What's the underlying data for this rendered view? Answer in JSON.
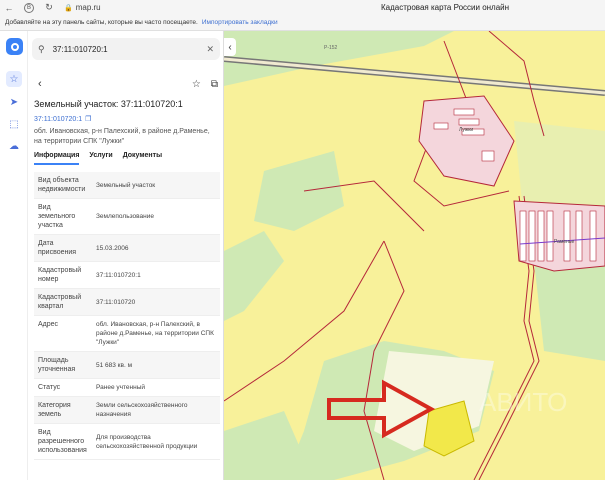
{
  "browser": {
    "url": "map.ru",
    "page_title": "Кадастровая карта России онлайн"
  },
  "bookmarks_bar": {
    "text": "Добавляйте на эту панель сайты, которые вы часто посещаете.",
    "import_link": "Импортировать закладки"
  },
  "search": {
    "query": "37:11:010720:1"
  },
  "parcel": {
    "heading": "Земельный участок: 37:11:010720:1",
    "cad_link": "37:11:010720:1",
    "address_short": "обл. Ивановская, р-н Палехский, в районе д.Раменье, на территории СПК \"Лужки\""
  },
  "tabs": [
    "Информация",
    "Услуги",
    "Документы"
  ],
  "info_rows": [
    {
      "key": "Вид объекта недвижимости",
      "value": "Земельный участок"
    },
    {
      "key": "Вид земельного участка",
      "value": "Землепользование"
    },
    {
      "key": "Дата присвоения",
      "value": "15.03.2006"
    },
    {
      "key": "Кадастровый номер",
      "value": "37:11:010720:1"
    },
    {
      "key": "Кадастровый квартал",
      "value": "37:11:010720"
    },
    {
      "key": "Адрес",
      "value": "обл. Ивановская, р-н Палехский, в районе д.Раменье, на территории СПК \"Лужки\""
    },
    {
      "key": "Площадь уточненная",
      "value": "51 683 кв. м"
    },
    {
      "key": "Статус",
      "value": "Ранее учтенный"
    },
    {
      "key": "Категория земель",
      "value": "Земли сельскохозяйственного назначения"
    },
    {
      "key": "Вид разрешенного использования",
      "value": "Для производства сельскохозяйственной продукции"
    }
  ],
  "map": {
    "road_label": "Р-152",
    "village_label_1": "Лужки",
    "village_label_2": "Раменье",
    "watermark": "АВИТО"
  },
  "colors": {
    "accent": "#3b82f6",
    "arrow": "#d62a1f",
    "highlight_parcel": "#f2e84a",
    "boundary": "#b5283a"
  }
}
